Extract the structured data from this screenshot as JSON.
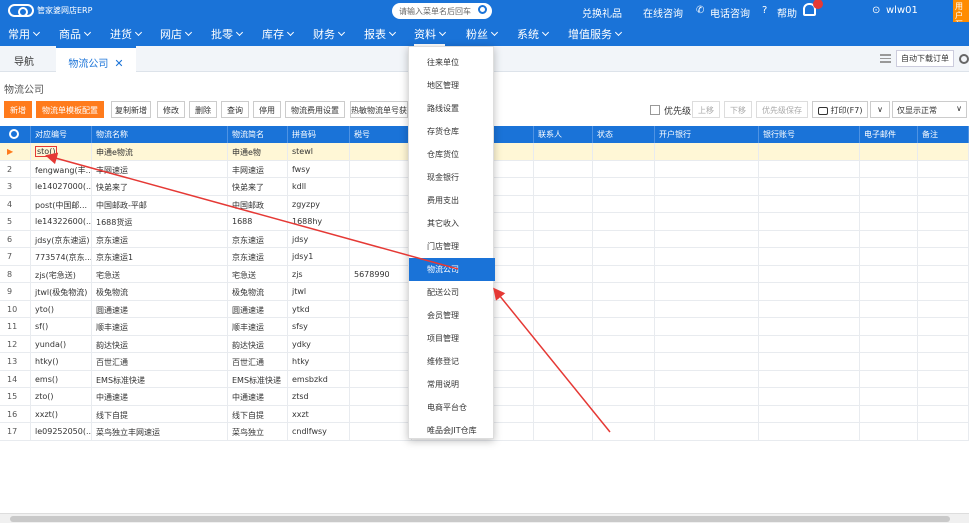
{
  "app": {
    "logo_text": "管家婆网店ERP"
  },
  "search": {
    "placeholder": "请输入菜单名后回车"
  },
  "top_links": {
    "gift": "兑换礼品",
    "online": "在线咨询",
    "phone": "电话咨询",
    "help": "帮助",
    "user": "wlw01",
    "right_btn": "用户互动"
  },
  "nav": [
    "常用",
    "商品",
    "进货",
    "网店",
    "批零",
    "库存",
    "财务",
    "报表",
    "资料",
    "粉丝",
    "系统",
    "增值服务"
  ],
  "tabs": {
    "nav_label": "导航",
    "active_label": "物流公司",
    "close": "✕",
    "auto_download": "自动下载订单"
  },
  "page_title": "物流公司",
  "toolbar": {
    "add": "新增",
    "template": "物流单模板配置",
    "copy_add": "复制新增",
    "edit": "修改",
    "delete": "删除",
    "query": "查询",
    "disable": "停用",
    "fee_settings": "物流费用设置",
    "hot_sensitive": "热敏物流单号获",
    "priority": "优先级",
    "move_up": "上移",
    "move_down": "下移",
    "priority_save": "优先级保存",
    "print": "打印(F7)",
    "show_normal": "仅显示正常"
  },
  "columns": [
    "对应编号",
    "物流名称",
    "物流简名",
    "拼音码",
    "税号",
    "",
    "联系人",
    "状态",
    "开户银行",
    "银行账号",
    "电子邮件",
    "备注"
  ],
  "rows": [
    {
      "n": "1",
      "code": "sto()",
      "name": "申通e物流",
      "short": "申通e物",
      "py": "stewl",
      "tax": ""
    },
    {
      "n": "2",
      "code": "fengwang(丰...",
      "name": "丰网速运",
      "short": "丰网速运",
      "py": "fwsy",
      "tax": ""
    },
    {
      "n": "3",
      "code": "le14027000(...",
      "name": "快弟来了",
      "short": "快弟来了",
      "py": "kdll",
      "tax": ""
    },
    {
      "n": "4",
      "code": "post(中国邮...",
      "name": "中国邮政-平邮",
      "short": "中国邮政",
      "py": "zgyzpy",
      "tax": ""
    },
    {
      "n": "5",
      "code": "le14322600(...",
      "name": "1688货运",
      "short": "1688",
      "py": "1688hy",
      "tax": ""
    },
    {
      "n": "6",
      "code": "jdsy(京东速运)",
      "name": "京东速运",
      "short": "京东速运",
      "py": "jdsy",
      "tax": ""
    },
    {
      "n": "7",
      "code": "773574(京东...",
      "name": "京东速运1",
      "short": "京东速运",
      "py": "jdsy1",
      "tax": ""
    },
    {
      "n": "8",
      "code": "zjs(宅急送)",
      "name": "宅急送",
      "short": "宅急送",
      "py": "zjs",
      "tax": "5678990"
    },
    {
      "n": "9",
      "code": "jtwl(极兔物流)",
      "name": "极兔物流",
      "short": "极兔物流",
      "py": "jtwl",
      "tax": ""
    },
    {
      "n": "10",
      "code": "yto()",
      "name": "圆通速递",
      "short": "圆通速递",
      "py": "ytkd",
      "tax": ""
    },
    {
      "n": "11",
      "code": "sf()",
      "name": "顺丰速运",
      "short": "顺丰速运",
      "py": "sfsy",
      "tax": ""
    },
    {
      "n": "12",
      "code": "yunda()",
      "name": "韵达快运",
      "short": "韵达快运",
      "py": "ydky",
      "tax": ""
    },
    {
      "n": "13",
      "code": "htky()",
      "name": "百世汇通",
      "short": "百世汇通",
      "py": "htky",
      "tax": ""
    },
    {
      "n": "14",
      "code": "ems()",
      "name": "EMS标准快递",
      "short": "EMS标准快递",
      "py": "emsbzkd",
      "tax": ""
    },
    {
      "n": "15",
      "code": "zto()",
      "name": "中通速递",
      "short": "中通速递",
      "py": "ztsd",
      "tax": ""
    },
    {
      "n": "16",
      "code": "xxzt()",
      "name": "线下自提",
      "short": "线下自提",
      "py": "xxzt",
      "tax": ""
    },
    {
      "n": "17",
      "code": "le09252050(...",
      "name": "菜鸟独立丰网速运",
      "short": "菜鸟独立",
      "py": "cndlfwsy",
      "tax": ""
    }
  ],
  "dropdown": [
    "往来单位",
    "地区管理",
    "路线设置",
    "存货仓库",
    "仓库货位",
    "现金银行",
    "费用支出",
    "其它收入",
    "门店管理",
    "物流公司",
    "配送公司",
    "会员管理",
    "项目管理",
    "维修登记",
    "常用说明",
    "电商平台仓",
    "唯品会JIT仓库"
  ],
  "colors": {
    "brand": "#1a73d8",
    "accent": "#ff7b1c",
    "annotation": "#e53935"
  }
}
